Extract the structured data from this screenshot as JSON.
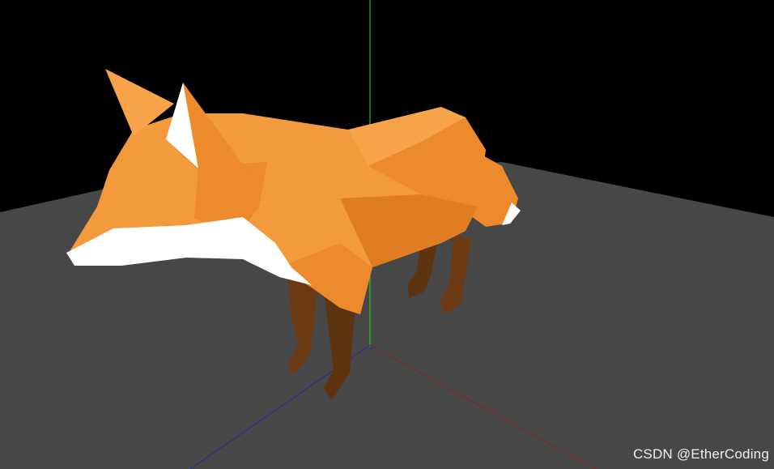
{
  "viewport": {
    "background_color": "#000000",
    "ground_color": "#474747",
    "axes": {
      "y_axis_color": "#22c322",
      "x_axis_color": "#7a2a2a",
      "z_axis_color": "#2a2f8a"
    },
    "model": {
      "kind": "low-poly fox",
      "fur_colors": [
        "#f39a3c",
        "#ec8a2c",
        "#e07c22",
        "#f7a34a"
      ],
      "white_fur_color": "#ffffff",
      "leg_color": "#6b3a14"
    }
  },
  "watermark": {
    "text": "CSDN @EtherCoding"
  }
}
